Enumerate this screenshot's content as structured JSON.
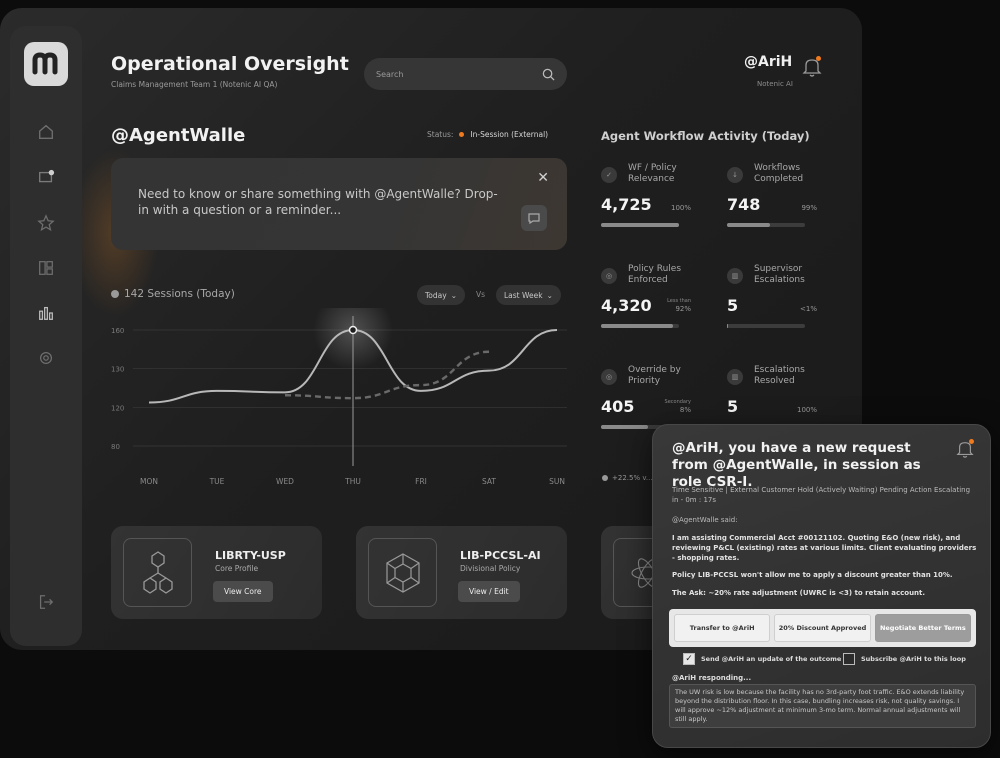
{
  "header": {
    "title": "Operational Oversight",
    "subtitle": "Claims Management Team 1 (Notenic AI QA)",
    "search_placeholder": "Search",
    "user_handle": "@AriH",
    "user_org": "Notenic AI"
  },
  "agent": {
    "title": "@AgentWalle",
    "status_label": "Status:",
    "status_value": "In-Session (External)",
    "prompt": "Need to know or share something with @AgentWalle? Drop-in with a question or a reminder...",
    "close_glyph": "✕"
  },
  "sessions": {
    "label": "142 Sessions (Today)",
    "period_a": "Today",
    "vs": "Vs",
    "period_b": "Last Week"
  },
  "chart_data": {
    "type": "line",
    "title": "",
    "x": [
      "MON",
      "TUE",
      "WED",
      "THU",
      "FRI",
      "SAT",
      "SUN"
    ],
    "y_ticks": [
      80,
      120,
      130,
      160
    ],
    "ylim": [
      80,
      160
    ],
    "highlight": "THU",
    "series": [
      {
        "values": [
          110,
          118,
          117,
          160,
          118,
          132,
          160
        ]
      },
      {
        "values": [
          null,
          null,
          115,
          113,
          122,
          145,
          null
        ]
      }
    ],
    "grid": true
  },
  "cards": [
    {
      "title": "LIBRTY-USP",
      "sub": "Core Profile",
      "btn": "View Core"
    },
    {
      "title": "LIB-PCCSL-AI",
      "sub": "Divisional Policy",
      "btn": "View / Edit"
    }
  ],
  "workflow": {
    "title": "Agent Workflow Activity (Today)",
    "metrics": [
      {
        "label": "WF / Policy Relevance",
        "value": "4,725",
        "pct": "100%",
        "fill": 1.0,
        "icon": "✓"
      },
      {
        "label": "Workflows Completed",
        "value": "748",
        "pct": "99%",
        "fill": 0.55,
        "icon": "↓"
      },
      {
        "label": "Policy Rules Enforced",
        "value": "4,320",
        "pct": "92%",
        "sub": "Less than",
        "fill": 0.92,
        "icon": "◎"
      },
      {
        "label": "Supervisor Escalations",
        "value": "5",
        "pct": "<1%",
        "fill": 0.01,
        "icon": "▥"
      },
      {
        "label": "Override by Priority",
        "value": "405",
        "pct": "8%",
        "sub": "Secondary",
        "fill": 0.6,
        "icon": "◎"
      },
      {
        "label": "Escalations Resolved",
        "value": "5",
        "pct": "100%",
        "fill": 1.0,
        "icon": "▥"
      }
    ],
    "legend_text": "+22.5% v..."
  },
  "notification": {
    "title": "@AriH, you have a new request from @AgentWalle, in session as role CSR-I.",
    "meta": "Time Sensitive | External Customer Hold (Actively Waiting) Pending Action Escalating in - 0m : 17s",
    "said": "@AgentWalle said:",
    "body1": "I am assisting Commercial Acct #00121102. Quoting E&O (new risk), and reviewing P&CL (existing) rates at various limits. Client evaluating providers - shopping rates.",
    "body2": "Policy LIB-PCCSL won't allow me to apply a discount greater than 10%.",
    "body3": "The Ask: ~20% rate adjustment (UWRC is <3) to retain account.",
    "actions": [
      "Transfer to @AriH",
      "20% Discount Approved",
      "Negotiate Better Terms"
    ],
    "check1": "Send @AriH an update of the outcome",
    "check2": "Subscribe @AriH to this loop",
    "check_mark": "✓",
    "resp_title": "@AriH responding...",
    "resp_body": "The UW risk is low because the facility has no 3rd-party foot traffic. E&O extends liability beyond the distribution floor. In this case, bundling increases risk, not quality savings. I will approve ~12% adjustment at minimum 3-mo term. Normal annual adjustments will still apply."
  },
  "colors": {
    "accent": "#f07a1e",
    "bg": "#1f1f1f",
    "panel": "#2e2e2e"
  }
}
